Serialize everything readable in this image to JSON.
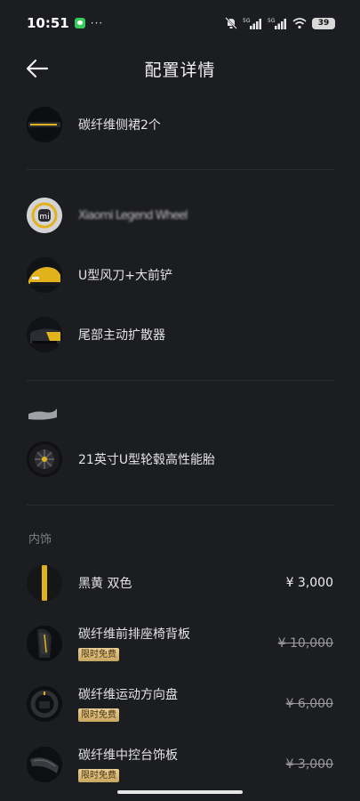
{
  "status_bar": {
    "time": "10:51",
    "dots": "···",
    "battery": "39",
    "network_a": "5G",
    "network_b": "5G"
  },
  "header": {
    "title": "配置详情"
  },
  "items_exterior": [
    {
      "label": "碳纤维侧裙2个",
      "icon": "carbon-side-skirt-thumb"
    },
    {
      "label": "",
      "icon": "xiaomi-logo-thumb",
      "blurred_text": "Xiaomi Legend Wheel"
    },
    {
      "label": "U型风刀+大前铲",
      "icon": "front-splitter-thumb"
    },
    {
      "label": "尾部主动扩散器",
      "icon": "rear-diffuser-thumb"
    },
    {
      "label": "21英寸U型轮毂高性能胎",
      "icon": "wheel-tire-thumb"
    }
  ],
  "interior": {
    "section_title": "内饰",
    "items": [
      {
        "label": "黑黄 双色",
        "price": "¥ 3,000",
        "icon": "black-yellow-color-thumb"
      },
      {
        "label": "碳纤维前排座椅背板",
        "price": "¥ 10,000",
        "tag": "限时免费",
        "icon": "carbon-seat-back-thumb"
      },
      {
        "label": "碳纤维运动方向盘",
        "price": "¥ 6,000",
        "tag": "限时免费",
        "icon": "carbon-steering-wheel-thumb"
      },
      {
        "label": "碳纤维中控台饰板",
        "price": "¥ 3,000",
        "tag": "限时免费",
        "icon": "carbon-console-trim-thumb"
      }
    ]
  },
  "colors": {
    "background": "#1c1d21",
    "accent_yellow": "#e2b21c",
    "tag_gold": "#d8b876"
  }
}
